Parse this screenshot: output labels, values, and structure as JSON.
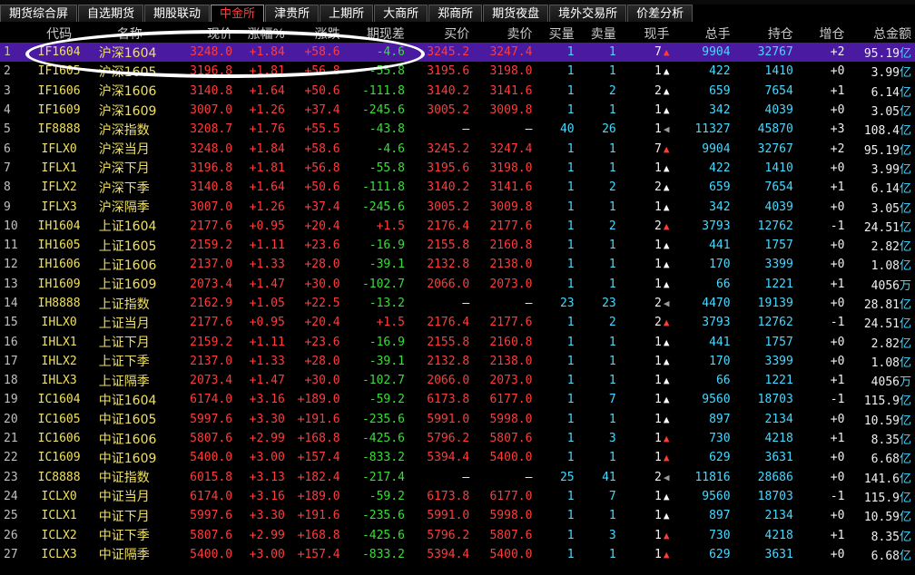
{
  "tabs": [
    {
      "label": "期货综合屏",
      "active": false
    },
    {
      "label": "自选期货",
      "active": false
    },
    {
      "label": "期股联动",
      "active": false
    },
    {
      "label": "中金所",
      "active": true
    },
    {
      "label": "津贵所",
      "active": false
    },
    {
      "label": "上期所",
      "active": false
    },
    {
      "label": "大商所",
      "active": false
    },
    {
      "label": "郑商所",
      "active": false
    },
    {
      "label": "期货夜盘",
      "active": false
    },
    {
      "label": "境外交易所",
      "active": false
    },
    {
      "label": "价差分析",
      "active": false
    }
  ],
  "columns": [
    "",
    "代码",
    "名称",
    "现价",
    "涨幅%",
    "涨跌",
    "期现差",
    "买价",
    "卖价",
    "买量",
    "卖量",
    "现手",
    "总手",
    "持仓",
    "增仓",
    "总金额"
  ],
  "colors": {
    "up": "#ff3c3c",
    "down": "#3cdc3c",
    "selected_row_bg": "#4a1aa0",
    "active_tab": "#ff3b3b"
  },
  "selected_row": 0,
  "rows": [
    {
      "idx": "1",
      "code": "IF1604",
      "name": "沪深1604",
      "price": "3248.0",
      "pct": "+1.84",
      "chg": "+58.6",
      "basis": "-4.6",
      "bid": "3245.2",
      "ask": "3247.4",
      "bidv": "1",
      "askv": "1",
      "hand": "7",
      "dir": "up-red",
      "vol": "9904",
      "oi": "32767",
      "inc": "+2",
      "amt": "95.19",
      "unit": "亿"
    },
    {
      "idx": "2",
      "code": "IF1605",
      "name": "沪深1605",
      "price": "3196.8",
      "pct": "+1.81",
      "chg": "+56.8",
      "basis": "-55.8",
      "bid": "3195.6",
      "ask": "3198.0",
      "bidv": "1",
      "askv": "1",
      "hand": "1",
      "dir": "up-white",
      "vol": "422",
      "oi": "1410",
      "inc": "+0",
      "amt": "3.99",
      "unit": "亿"
    },
    {
      "idx": "3",
      "code": "IF1606",
      "name": "沪深1606",
      "price": "3140.8",
      "pct": "+1.64",
      "chg": "+50.6",
      "basis": "-111.8",
      "bid": "3140.2",
      "ask": "3141.6",
      "bidv": "1",
      "askv": "2",
      "hand": "2",
      "dir": "up-white",
      "vol": "659",
      "oi": "7654",
      "inc": "+1",
      "amt": "6.14",
      "unit": "亿"
    },
    {
      "idx": "4",
      "code": "IF1609",
      "name": "沪深1609",
      "price": "3007.0",
      "pct": "+1.26",
      "chg": "+37.4",
      "basis": "-245.6",
      "bid": "3005.2",
      "ask": "3009.8",
      "bidv": "1",
      "askv": "1",
      "hand": "1",
      "dir": "up-white",
      "vol": "342",
      "oi": "4039",
      "inc": "+0",
      "amt": "3.05",
      "unit": "亿"
    },
    {
      "idx": "5",
      "code": "IF8888",
      "name": "沪深指数",
      "price": "3208.7",
      "pct": "+1.76",
      "chg": "+55.5",
      "basis": "-43.8",
      "bid": "–",
      "ask": "–",
      "bidv": "40",
      "askv": "26",
      "hand": "1",
      "dir": "left-gray",
      "vol": "11327",
      "oi": "45870",
      "inc": "+3",
      "amt": "108.4",
      "unit": "亿"
    },
    {
      "idx": "6",
      "code": "IFLX0",
      "name": "沪深当月",
      "price": "3248.0",
      "pct": "+1.84",
      "chg": "+58.6",
      "basis": "-4.6",
      "bid": "3245.2",
      "ask": "3247.4",
      "bidv": "1",
      "askv": "1",
      "hand": "7",
      "dir": "up-red",
      "vol": "9904",
      "oi": "32767",
      "inc": "+2",
      "amt": "95.19",
      "unit": "亿"
    },
    {
      "idx": "7",
      "code": "IFLX1",
      "name": "沪深下月",
      "price": "3196.8",
      "pct": "+1.81",
      "chg": "+56.8",
      "basis": "-55.8",
      "bid": "3195.6",
      "ask": "3198.0",
      "bidv": "1",
      "askv": "1",
      "hand": "1",
      "dir": "up-white",
      "vol": "422",
      "oi": "1410",
      "inc": "+0",
      "amt": "3.99",
      "unit": "亿"
    },
    {
      "idx": "8",
      "code": "IFLX2",
      "name": "沪深下季",
      "price": "3140.8",
      "pct": "+1.64",
      "chg": "+50.6",
      "basis": "-111.8",
      "bid": "3140.2",
      "ask": "3141.6",
      "bidv": "1",
      "askv": "2",
      "hand": "2",
      "dir": "up-white",
      "vol": "659",
      "oi": "7654",
      "inc": "+1",
      "amt": "6.14",
      "unit": "亿"
    },
    {
      "idx": "9",
      "code": "IFLX3",
      "name": "沪深隔季",
      "price": "3007.0",
      "pct": "+1.26",
      "chg": "+37.4",
      "basis": "-245.6",
      "bid": "3005.2",
      "ask": "3009.8",
      "bidv": "1",
      "askv": "1",
      "hand": "1",
      "dir": "up-white",
      "vol": "342",
      "oi": "4039",
      "inc": "+0",
      "amt": "3.05",
      "unit": "亿"
    },
    {
      "idx": "10",
      "code": "IH1604",
      "name": "上证1604",
      "price": "2177.6",
      "pct": "+0.95",
      "chg": "+20.4",
      "basis": "+1.5",
      "bid": "2176.4",
      "ask": "2177.6",
      "bidv": "1",
      "askv": "2",
      "hand": "2",
      "dir": "up-red",
      "vol": "3793",
      "oi": "12762",
      "inc": "-1",
      "amt": "24.51",
      "unit": "亿"
    },
    {
      "idx": "11",
      "code": "IH1605",
      "name": "上证1605",
      "price": "2159.2",
      "pct": "+1.11",
      "chg": "+23.6",
      "basis": "-16.9",
      "bid": "2155.8",
      "ask": "2160.8",
      "bidv": "1",
      "askv": "1",
      "hand": "1",
      "dir": "up-white",
      "vol": "441",
      "oi": "1757",
      "inc": "+0",
      "amt": "2.82",
      "unit": "亿"
    },
    {
      "idx": "12",
      "code": "IH1606",
      "name": "上证1606",
      "price": "2137.0",
      "pct": "+1.33",
      "chg": "+28.0",
      "basis": "-39.1",
      "bid": "2132.8",
      "ask": "2138.0",
      "bidv": "1",
      "askv": "1",
      "hand": "1",
      "dir": "up-white",
      "vol": "170",
      "oi": "3399",
      "inc": "+0",
      "amt": "1.08",
      "unit": "亿"
    },
    {
      "idx": "13",
      "code": "IH1609",
      "name": "上证1609",
      "price": "2073.4",
      "pct": "+1.47",
      "chg": "+30.0",
      "basis": "-102.7",
      "bid": "2066.0",
      "ask": "2073.0",
      "bidv": "1",
      "askv": "1",
      "hand": "1",
      "dir": "up-white",
      "vol": "66",
      "oi": "1221",
      "inc": "+1",
      "amt": "4056",
      "unit": "万"
    },
    {
      "idx": "14",
      "code": "IH8888",
      "name": "上证指数",
      "price": "2162.9",
      "pct": "+1.05",
      "chg": "+22.5",
      "basis": "-13.2",
      "bid": "–",
      "ask": "–",
      "bidv": "23",
      "askv": "23",
      "hand": "2",
      "dir": "left-gray",
      "vol": "4470",
      "oi": "19139",
      "inc": "+0",
      "amt": "28.81",
      "unit": "亿"
    },
    {
      "idx": "15",
      "code": "IHLX0",
      "name": "上证当月",
      "price": "2177.6",
      "pct": "+0.95",
      "chg": "+20.4",
      "basis": "+1.5",
      "bid": "2176.4",
      "ask": "2177.6",
      "bidv": "1",
      "askv": "2",
      "hand": "2",
      "dir": "up-red",
      "vol": "3793",
      "oi": "12762",
      "inc": "-1",
      "amt": "24.51",
      "unit": "亿"
    },
    {
      "idx": "16",
      "code": "IHLX1",
      "name": "上证下月",
      "price": "2159.2",
      "pct": "+1.11",
      "chg": "+23.6",
      "basis": "-16.9",
      "bid": "2155.8",
      "ask": "2160.8",
      "bidv": "1",
      "askv": "1",
      "hand": "1",
      "dir": "up-white",
      "vol": "441",
      "oi": "1757",
      "inc": "+0",
      "amt": "2.82",
      "unit": "亿"
    },
    {
      "idx": "17",
      "code": "IHLX2",
      "name": "上证下季",
      "price": "2137.0",
      "pct": "+1.33",
      "chg": "+28.0",
      "basis": "-39.1",
      "bid": "2132.8",
      "ask": "2138.0",
      "bidv": "1",
      "askv": "1",
      "hand": "1",
      "dir": "up-white",
      "vol": "170",
      "oi": "3399",
      "inc": "+0",
      "amt": "1.08",
      "unit": "亿"
    },
    {
      "idx": "18",
      "code": "IHLX3",
      "name": "上证隔季",
      "price": "2073.4",
      "pct": "+1.47",
      "chg": "+30.0",
      "basis": "-102.7",
      "bid": "2066.0",
      "ask": "2073.0",
      "bidv": "1",
      "askv": "1",
      "hand": "1",
      "dir": "up-white",
      "vol": "66",
      "oi": "1221",
      "inc": "+1",
      "amt": "4056",
      "unit": "万"
    },
    {
      "idx": "19",
      "code": "IC1604",
      "name": "中证1604",
      "price": "6174.0",
      "pct": "+3.16",
      "chg": "+189.0",
      "basis": "-59.2",
      "bid": "6173.8",
      "ask": "6177.0",
      "bidv": "1",
      "askv": "7",
      "hand": "1",
      "dir": "up-white",
      "vol": "9560",
      "oi": "18703",
      "inc": "-1",
      "amt": "115.9",
      "unit": "亿"
    },
    {
      "idx": "20",
      "code": "IC1605",
      "name": "中证1605",
      "price": "5997.6",
      "pct": "+3.30",
      "chg": "+191.6",
      "basis": "-235.6",
      "bid": "5991.0",
      "ask": "5998.0",
      "bidv": "1",
      "askv": "1",
      "hand": "1",
      "dir": "up-white",
      "vol": "897",
      "oi": "2134",
      "inc": "+0",
      "amt": "10.59",
      "unit": "亿"
    },
    {
      "idx": "21",
      "code": "IC1606",
      "name": "中证1606",
      "price": "5807.6",
      "pct": "+2.99",
      "chg": "+168.8",
      "basis": "-425.6",
      "bid": "5796.2",
      "ask": "5807.6",
      "bidv": "1",
      "askv": "3",
      "hand": "1",
      "dir": "up-red",
      "vol": "730",
      "oi": "4218",
      "inc": "+1",
      "amt": "8.35",
      "unit": "亿"
    },
    {
      "idx": "22",
      "code": "IC1609",
      "name": "中证1609",
      "price": "5400.0",
      "pct": "+3.00",
      "chg": "+157.4",
      "basis": "-833.2",
      "bid": "5394.4",
      "ask": "5400.0",
      "bidv": "1",
      "askv": "1",
      "hand": "1",
      "dir": "up-red",
      "vol": "629",
      "oi": "3631",
      "inc": "+0",
      "amt": "6.68",
      "unit": "亿"
    },
    {
      "idx": "23",
      "code": "IC8888",
      "name": "中证指数",
      "price": "6015.8",
      "pct": "+3.13",
      "chg": "+182.4",
      "basis": "-217.4",
      "bid": "–",
      "ask": "–",
      "bidv": "25",
      "askv": "41",
      "hand": "2",
      "dir": "left-gray",
      "vol": "11816",
      "oi": "28686",
      "inc": "+0",
      "amt": "141.6",
      "unit": "亿"
    },
    {
      "idx": "24",
      "code": "ICLX0",
      "name": "中证当月",
      "price": "6174.0",
      "pct": "+3.16",
      "chg": "+189.0",
      "basis": "-59.2",
      "bid": "6173.8",
      "ask": "6177.0",
      "bidv": "1",
      "askv": "7",
      "hand": "1",
      "dir": "up-white",
      "vol": "9560",
      "oi": "18703",
      "inc": "-1",
      "amt": "115.9",
      "unit": "亿"
    },
    {
      "idx": "25",
      "code": "ICLX1",
      "name": "中证下月",
      "price": "5997.6",
      "pct": "+3.30",
      "chg": "+191.6",
      "basis": "-235.6",
      "bid": "5991.0",
      "ask": "5998.0",
      "bidv": "1",
      "askv": "1",
      "hand": "1",
      "dir": "up-white",
      "vol": "897",
      "oi": "2134",
      "inc": "+0",
      "amt": "10.59",
      "unit": "亿"
    },
    {
      "idx": "26",
      "code": "ICLX2",
      "name": "中证下季",
      "price": "5807.6",
      "pct": "+2.99",
      "chg": "+168.8",
      "basis": "-425.6",
      "bid": "5796.2",
      "ask": "5807.6",
      "bidv": "1",
      "askv": "3",
      "hand": "1",
      "dir": "up-red",
      "vol": "730",
      "oi": "4218",
      "inc": "+1",
      "amt": "8.35",
      "unit": "亿"
    },
    {
      "idx": "27",
      "code": "ICLX3",
      "name": "中证隔季",
      "price": "5400.0",
      "pct": "+3.00",
      "chg": "+157.4",
      "basis": "-833.2",
      "bid": "5394.4",
      "ask": "5400.0",
      "bidv": "1",
      "askv": "1",
      "hand": "1",
      "dir": "up-red",
      "vol": "629",
      "oi": "3631",
      "inc": "+0",
      "amt": "6.68",
      "unit": "亿"
    }
  ]
}
